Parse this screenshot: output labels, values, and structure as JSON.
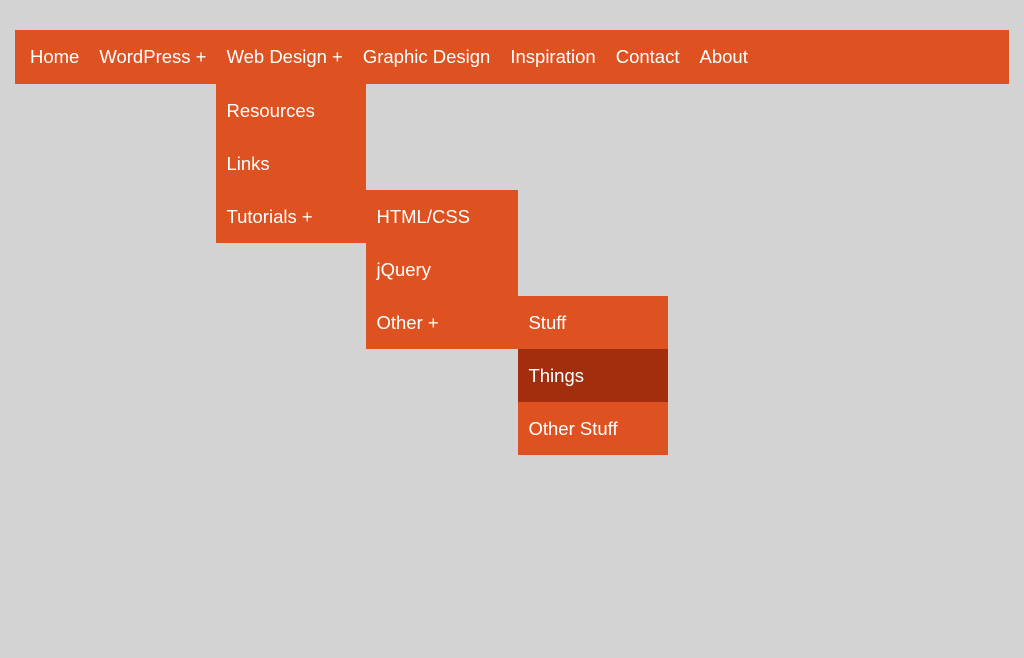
{
  "nav": {
    "items": [
      {
        "label": "Home"
      },
      {
        "label": "WordPress +"
      },
      {
        "label": "Web Design +"
      },
      {
        "label": "Graphic Design"
      },
      {
        "label": "Inspiration"
      },
      {
        "label": "Contact"
      },
      {
        "label": "About"
      }
    ]
  },
  "submenu_webdesign": {
    "items": [
      {
        "label": "Resources"
      },
      {
        "label": "Links"
      },
      {
        "label": "Tutorials +"
      }
    ]
  },
  "submenu_tutorials": {
    "items": [
      {
        "label": "HTML/CSS"
      },
      {
        "label": "jQuery"
      },
      {
        "label": "Other +"
      }
    ]
  },
  "submenu_other": {
    "items": [
      {
        "label": "Stuff"
      },
      {
        "label": "Things"
      },
      {
        "label": "Other Stuff"
      }
    ]
  }
}
